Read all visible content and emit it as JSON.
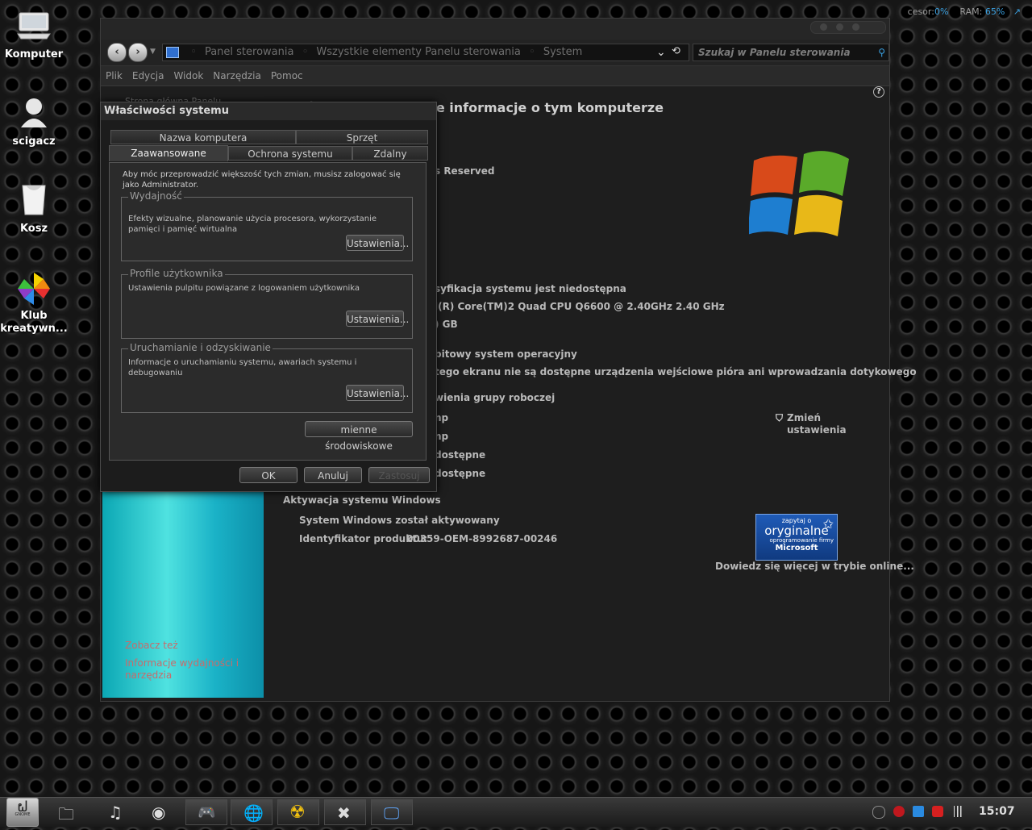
{
  "desktop": {
    "icons": [
      {
        "label": "Komputer"
      },
      {
        "label": "scigacz"
      },
      {
        "label": "Kosz"
      },
      {
        "label": "Klub kreatywn..."
      }
    ]
  },
  "meters": {
    "cpu_label": "cesor:",
    "cpu_value": "0%",
    "ram_label": "RAM:",
    "ram_value": "65%"
  },
  "explorer": {
    "address": {
      "part1": "Panel sterowania",
      "part2": "Wszystkie elementy Panelu sterowania",
      "part3": "System"
    },
    "search_placeholder": "Szukaj w Panelu sterowania",
    "menu": [
      "Plik",
      "Edycja",
      "Widok",
      "Narzędzia",
      "Pomoc"
    ],
    "heading": "Wyświetl podstawowe informacje o tym komputerze",
    "sidebar_partial": "Strona główna Panelu",
    "see_also": "Zobacz też",
    "see_also_link": "Informacje wydajności i narzędzia",
    "lines": {
      "reserved": "s Reserved",
      "rating": "syfikacja systemu jest niedostępna",
      "cpu": "l(R) Core(TM)2 Quad CPU    Q6600  @ 2.40GHz   2.40 GHz",
      "ram": ") GB",
      "os_type": "bitowy system operacyjny",
      "pen": "tego ekranu nie są dostępne urządzenia wejściowe pióra ani wprowadzania dotykowego",
      "workgroup": "wienia grupy roboczej",
      "wg1": "np",
      "wg2": "np",
      "wg3": "dostępne",
      "wg4": "dostępne",
      "change": "Zmień ustawienia",
      "activation_title": "Aktywacja systemu Windows",
      "activated": "System Windows został aktywowany",
      "product_id_label": "Identyfikator produktu:",
      "product_id": "00359-OEM-8992687-00246",
      "learn_more": "Dowiedz się więcej w trybie online...",
      "badge_top": "zapytaj o",
      "badge_main": "oryginalne",
      "badge_sub": "oprogramowanie firmy",
      "badge_brand": "Microsoft"
    }
  },
  "dialog": {
    "title": "Właściwości systemu",
    "tabs_top": [
      "Nazwa komputera",
      "Sprzęt"
    ],
    "tabs_bottom": [
      "Zaawansowane",
      "Ochrona systemu",
      "Zdalny"
    ],
    "admin_note": "Aby móc przeprowadzić większość tych zmian, musisz zalogować się jako Administrator.",
    "groups": [
      {
        "title": "Wydajność",
        "desc": "Efekty wizualne, planowanie użycia procesora, wykorzystanie pamięci i pamięć wirtualna",
        "button": "Ustawienia..."
      },
      {
        "title": "Profile użytkownika",
        "desc": "Ustawienia pulpitu powiązane z logowaniem użytkownika",
        "button": "Ustawienia..."
      },
      {
        "title": "Uruchamianie i odzyskiwanie",
        "desc": "Informacje o uruchamianiu systemu, awariach systemu i debugowaniu",
        "button": "Ustawienia..."
      }
    ],
    "env_button": "mienne środowiskowe",
    "ok": "OK",
    "cancel": "Anuluj",
    "apply": "Zastosuj"
  },
  "taskbar": {
    "start_label": "GNOME",
    "clock": "15:07"
  }
}
